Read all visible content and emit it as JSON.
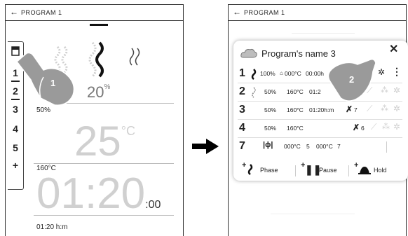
{
  "left_screen": {
    "topbar": {
      "back_icon": "←",
      "title": "PROGRAM 1"
    },
    "sidebar": {
      "items": [
        "1",
        "2",
        "3",
        "4",
        "5",
        "+"
      ]
    },
    "humidity_top": "20",
    "humidity_top_unit": "%",
    "humidity_left": "50%",
    "temp_current": "25",
    "temp_unit": "°C",
    "temp_set": "160°C",
    "time_big": "01:20",
    "time_small": ":00",
    "time_set": "01:20 h:m",
    "step_badge": "1"
  },
  "right_screen": {
    "topbar": {
      "back_icon": "←",
      "title": "PROGRAM 1"
    },
    "popup": {
      "title": "Program's name 3",
      "close_icon": "✕",
      "step_badge": "2",
      "rows": [
        {
          "num": "1",
          "humidity": "100%",
          "temp": "000°C",
          "time": "00:00h"
        },
        {
          "num": "2",
          "humidity": "50%",
          "temp": "160°C",
          "time": "01:2"
        },
        {
          "num": "3",
          "humidity": "50%",
          "temp": "160°C",
          "time": "01:20h:m",
          "fan": "7"
        },
        {
          "num": "4",
          "humidity": "50%",
          "temp": "160°C",
          "fan": "6"
        },
        {
          "num": "7",
          "val_a": "000°C",
          "val_b": "5",
          "val_c": "000°C",
          "val_d": "7"
        }
      ],
      "tabs": {
        "phase": "Phase",
        "pause": "Pause",
        "hold": "Hold"
      }
    }
  },
  "colors": {
    "accent_finger": "#8c8c8c",
    "text": "#222222",
    "muted": "#cfcfcf"
  }
}
